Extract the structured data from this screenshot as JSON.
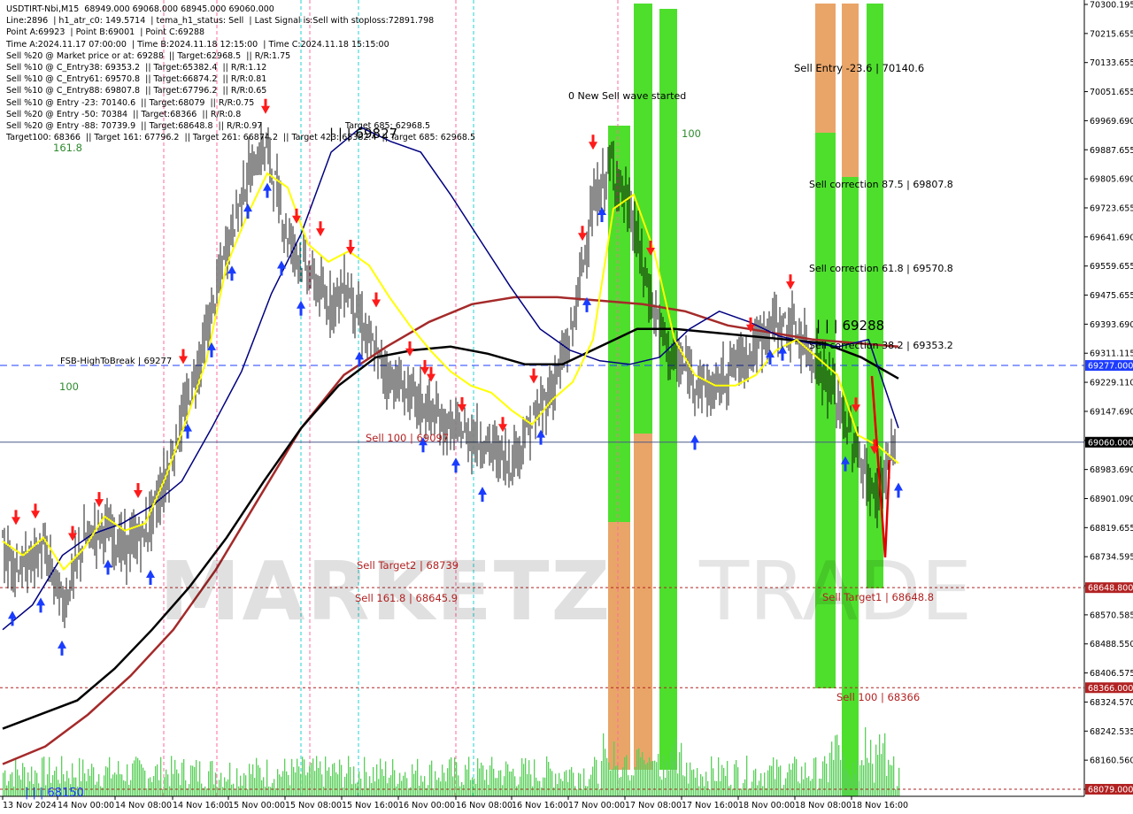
{
  "chart_data": {
    "type": "candlestick",
    "symbol": "USDTIRT-Nbi,M15",
    "info_lines": [
      "USDTIRT-Nbi,M15  68949.000 69068.000 68945.000 69060.000",
      "Line:2896  | h1_atr_c0: 149.5714  | tema_h1_status: Sell  | Last Signal is:Sell with stoploss:72891.798",
      "Point A:69923  | Point B:69001  | Point C:69288",
      "Time A:2024.11.17 07:00:00  | Time B:2024.11.18 12:15:00  | Time C:2024.11.18 15:15:00",
      "Sell %20 @ Market price or at: 69288  || Target:62968.5  || R/R:1.75",
      "Sell %10 @ C_Entry38: 69353.2  || Target:65382.4  || R/R:1.12",
      "Sell %10 @ C_Entry61: 69570.8  || Target:66874.2  || R/R:0.81",
      "Sell %10 @ C_Entry88: 69807.8  || Target:67796.2  || R/R:0.65",
      "Sell %10 @ Entry -23: 70140.6  || Target:68079  || R/R:0.75",
      "Sell %20 @ Entry -50: 70384  || Target:68366  || R/R:0.8",
      "Sell %20 @ Entry -88: 70739.9  || Target:68648.8  || R/R:0.97",
      "Target100: 68366  || Target 161: 67796.2  || Target 261: 66874.2  || Target 423: 65382.4  || Target 685: 62968.5"
    ],
    "y_ticks": [
      "70300.195",
      "70215.655",
      "70133.655",
      "70051.655",
      "69969.690",
      "69887.655",
      "69805.690",
      "69723.655",
      "69641.690",
      "69559.655",
      "69475.655",
      "69393.690",
      "69311.115",
      "69229.110",
      "69147.690",
      "69065.655",
      "68983.690",
      "68901.090",
      "68819.655",
      "68734.595",
      "68652.555",
      "68570.585",
      "68488.550",
      "68406.575",
      "68324.570",
      "68242.535",
      "68160.560",
      "68079.525"
    ],
    "ylim": [
      68079,
      70300
    ],
    "x_ticks": [
      "13 Nov 2024",
      "14 Nov 00:00",
      "14 Nov 08:00",
      "14 Nov 16:00",
      "15 Nov 00:00",
      "15 Nov 08:00",
      "15 Nov 16:00",
      "16 Nov 00:00",
      "16 Nov 08:00",
      "16 Nov 16:00",
      "17 Nov 00:00",
      "17 Nov 08:00",
      "17 Nov 16:00",
      "18 Nov 00:00",
      "18 Nov 08:00",
      "18 Nov 16:00"
    ],
    "price_labels": [
      {
        "text": "69277.000",
        "value": 69277,
        "bg": "#1e3cff"
      },
      {
        "text": "69060.000",
        "value": 69060,
        "bg": "#000000"
      },
      {
        "text": "68648.800",
        "value": 68648.8,
        "bg": "#b22222"
      },
      {
        "text": "68366.000",
        "value": 68366,
        "bg": "#b22222"
      },
      {
        "text": "68079.000",
        "value": 68079,
        "bg": "#b22222"
      }
    ],
    "hlines": [
      {
        "value": 69277,
        "color": "#1e3cff",
        "style": "dashed"
      },
      {
        "value": 69060,
        "color": "#4a5a8a",
        "style": "solid"
      },
      {
        "value": 68648.8,
        "color": "#b22222",
        "style": "dotted"
      },
      {
        "value": 68366,
        "color": "#b22222",
        "style": "dotted"
      },
      {
        "value": 68079,
        "color": "#b22222",
        "style": "dotted"
      }
    ],
    "annotations": {
      "sell_entry": "Sell Entry -23.6 | 70140.6",
      "new_wave": "0 New Sell wave started",
      "hundred_top": "100",
      "corr_875": "Sell correction 87.5 | 69807.8",
      "corr_618": "Sell correction 61.8 | 69570.8",
      "corr_382": "Sell correction 38.2 | 69353.2",
      "point_c": "| | | 69288",
      "point_a": "| | | 69827",
      "target_text": "Target 685: 62968.5",
      "fsb": "FSB-HighToBreak | 69277",
      "hundred_left": "100",
      "fib_1618": "161.8",
      "sell100_mid": "Sell 100 | 69097",
      "sell_target2": "Sell Target2 | 68739",
      "sell_1618": "Sell 161.8 | 68645.9",
      "sell_target1": "Sell Target1 | 68648.8",
      "sell100_low": "Sell 100 | 68366",
      "low_mark": "| | | 68150"
    },
    "moving_averages": {
      "yellow": [
        68780,
        68740,
        68790,
        68700,
        68760,
        68850,
        68810,
        68830,
        68960,
        69120,
        69290,
        69560,
        69700,
        69820,
        69780,
        69620,
        69570,
        69600,
        69560,
        69470,
        69390,
        69320,
        69260,
        69220,
        69200,
        69150,
        69110,
        69180,
        69230,
        69350,
        69720,
        69760,
        69600,
        69350,
        69250,
        69220,
        69220,
        69250,
        69320,
        69350,
        69300,
        69250,
        69080,
        69050,
        69000
      ],
      "navy": [
        68530,
        68600,
        68740,
        68800,
        68830,
        68880,
        68950,
        69100,
        69260,
        69480,
        69650,
        69880,
        69950,
        69910,
        69880,
        69760,
        69630,
        69500,
        69380,
        69320,
        69290,
        69280,
        69300,
        69380,
        69430,
        69400,
        69360,
        69340,
        69330,
        69350,
        69100
      ],
      "black": [
        68250,
        68290,
        68330,
        68420,
        68530,
        68650,
        68790,
        68950,
        69100,
        69220,
        69300,
        69320,
        69330,
        69310,
        69280,
        69280,
        69330,
        69380,
        69380,
        69370,
        69360,
        69350,
        69340,
        69300,
        69240
      ],
      "darkred": [
        68150,
        68200,
        68290,
        68400,
        68530,
        68700,
        68900,
        69100,
        69250,
        69330,
        69400,
        69450,
        69470,
        69470,
        69460,
        69450,
        69430,
        69390,
        69370,
        69350,
        69340,
        69330
      ]
    },
    "watermark_left": "MARKETZ",
    "watermark_right": "TRADE",
    "grid": false,
    "colors": {
      "bg": "#ffffff",
      "bull": "#000000",
      "volume": "#5ad05a",
      "green_zone": "#44dd22",
      "orange_zone": "#e8a060",
      "ma_yellow": "#ffff00",
      "ma_navy": "#000080",
      "ma_black": "#000000",
      "ma_red": "#a52a2a",
      "sell_arrow": "#ff1a1a",
      "buy_arrow": "#1a3cff"
    }
  }
}
